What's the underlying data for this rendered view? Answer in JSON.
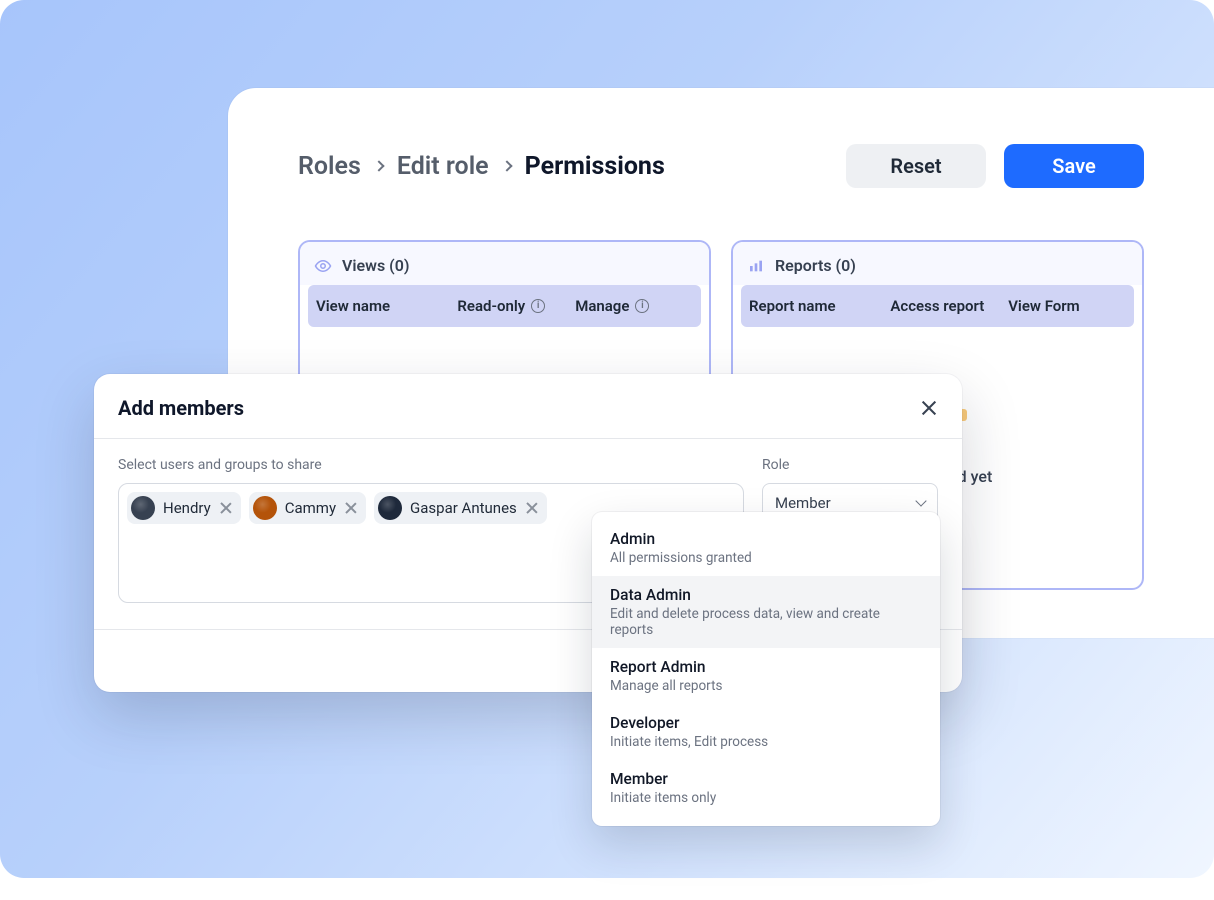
{
  "breadcrumb": {
    "level1": "Roles",
    "level2": "Edit role",
    "level3": "Permissions"
  },
  "buttons": {
    "reset": "Reset",
    "save": "Save"
  },
  "panels": {
    "views": {
      "title": "Views (0)",
      "cols": {
        "name": "View name",
        "readonly": "Read-only",
        "manage": "Manage"
      }
    },
    "reports": {
      "title": "Reports (0)",
      "cols": {
        "name": "Report name",
        "access": "Access report",
        "viewform": "View Form"
      },
      "empty_text_tail": "een created yet"
    }
  },
  "modal": {
    "title": "Add members",
    "share_label": "Select users and groups to share",
    "role_label": "Role",
    "role_selected": "Member",
    "chips": [
      {
        "name": "Hendry"
      },
      {
        "name": "Cammy"
      },
      {
        "name": "Gaspar Antunes"
      }
    ]
  },
  "role_options": [
    {
      "title": "Admin",
      "sub": "All permissions granted",
      "highlight": false
    },
    {
      "title": "Data Admin",
      "sub": "Edit and delete process data, view and create reports",
      "highlight": true
    },
    {
      "title": "Report Admin",
      "sub": "Manage all reports",
      "highlight": false
    },
    {
      "title": "Developer",
      "sub": "Initiate items, Edit process",
      "highlight": false
    },
    {
      "title": "Member",
      "sub": "Initiate items only",
      "highlight": false
    }
  ],
  "colors": {
    "accent": "#1e6bff"
  }
}
